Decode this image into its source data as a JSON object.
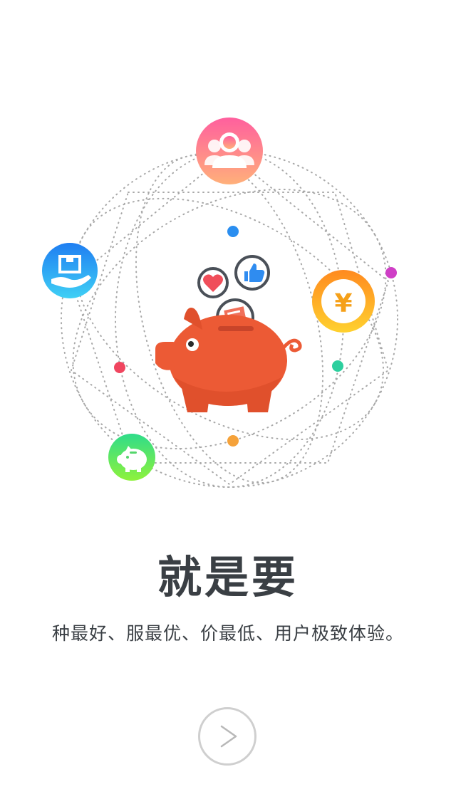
{
  "title": "就是要",
  "subtitle": "种最好、服最优、价最低、用户极致体验。",
  "next_button": {
    "icon": "chevron-right-icon"
  },
  "icons": {
    "top": "users-icon",
    "left": "hand-box-icon",
    "right": "yen-coin-icon",
    "bottom_left": "piggy-icon",
    "center": "piggy-bank-icon",
    "heart": "heart-icon",
    "thumb": "thumbs-up-icon",
    "card": "card-icon"
  },
  "colors": {
    "pig": "#ec5a35",
    "text": "#3a3f44",
    "dots": [
      "#2a8ef0",
      "#cf3fc6",
      "#2ccf9e",
      "#f0455f",
      "#f5a23a"
    ]
  }
}
